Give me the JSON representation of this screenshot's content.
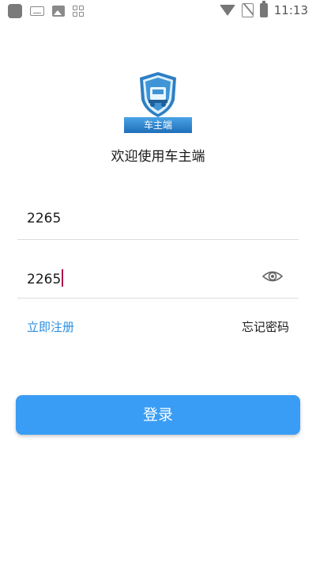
{
  "status_bar": {
    "time": "11:13",
    "icons": [
      "app-icon",
      "keyboard-icon",
      "image-icon",
      "widgets-icon",
      "wifi-icon",
      "no-sim-icon",
      "battery-charging-icon"
    ]
  },
  "logo": {
    "caption": "车主端"
  },
  "welcome_text": "欢迎使用车主端",
  "form": {
    "username_value": "2265",
    "password_value": "2265",
    "password_toggle_icon": "eye-icon"
  },
  "links": {
    "register": "立即注册",
    "forgot_password": "忘记密码"
  },
  "login_button": "登录",
  "colors": {
    "primary": "#3a9df5",
    "link": "#2a8ee0",
    "caret": "#b0154c"
  }
}
